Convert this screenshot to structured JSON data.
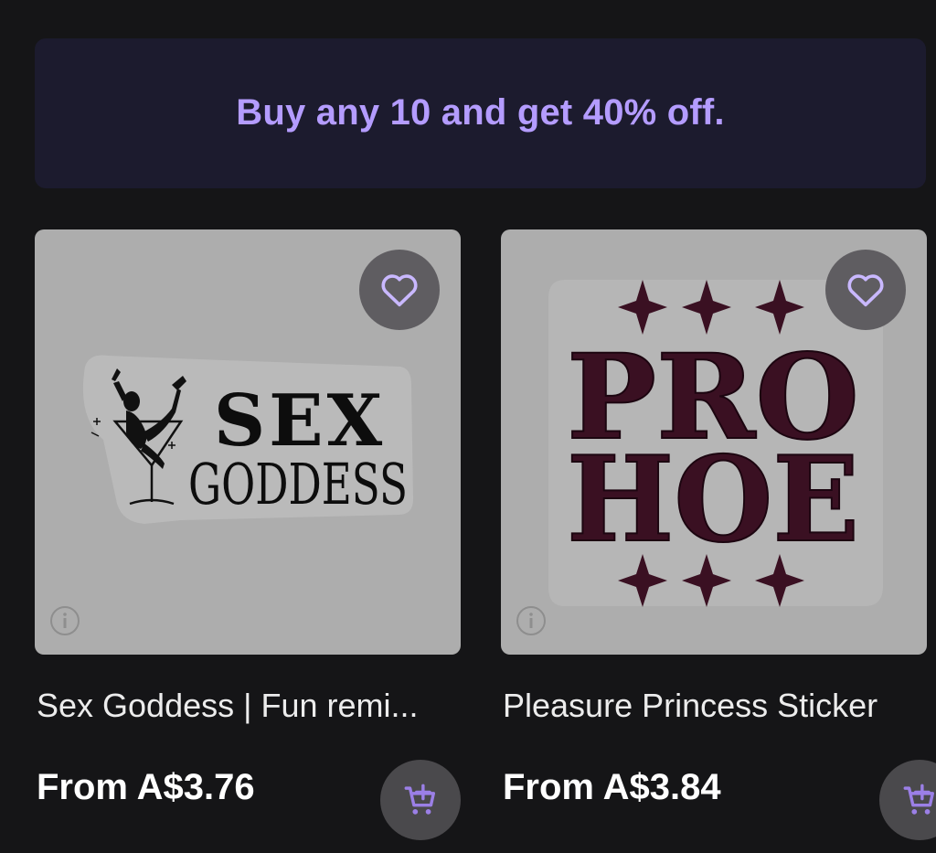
{
  "promo": {
    "text": "Buy any 10 and get 40% off."
  },
  "products": [
    {
      "title": "Sex Goddess | Fun remi...",
      "price": "From A$3.76",
      "art_text": [
        "SEX",
        "GODDESS"
      ],
      "favorite_icon": "heart-outline-icon",
      "info_icon": "info-icon",
      "cart_icon": "add-to-cart-icon"
    },
    {
      "title": "Pleasure Princess Sticker",
      "price": "From A$3.84",
      "art_text": [
        "PRO",
        "HOE"
      ],
      "favorite_icon": "heart-outline-icon",
      "info_icon": "info-icon",
      "cart_icon": "add-to-cart-icon"
    }
  ],
  "colors": {
    "background": "#151517",
    "promo_bg": "#1c1b2e",
    "promo_text": "#b49cff",
    "thumb_bg": "#adadad",
    "accent_purple": "#9b7fe6",
    "sticker_dark_red": "#3a1022"
  }
}
